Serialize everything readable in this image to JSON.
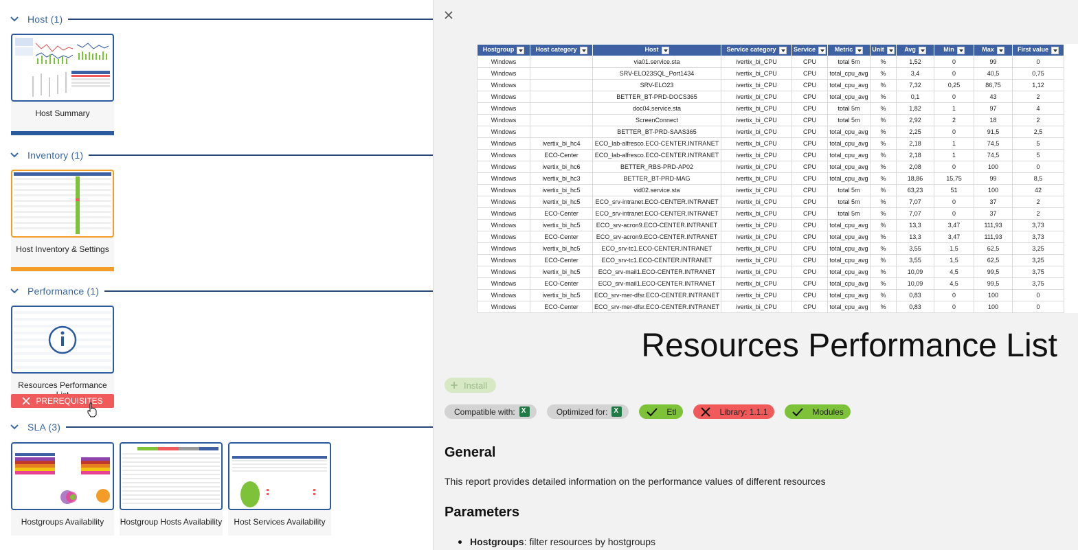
{
  "sections": {
    "host": {
      "title": "Host (1)",
      "card": {
        "label": "Host Summary",
        "bar_color": "#2c5a9e"
      }
    },
    "inventory": {
      "title": "Inventory (1)",
      "card": {
        "label": "Host Inventory & Settings",
        "bar_color": "#f39c28"
      }
    },
    "performance": {
      "title": "Performance (1)",
      "card": {
        "label": "Resources Performance List",
        "prerequisites_label": "PREREQUISITES"
      }
    },
    "sla": {
      "title": "SLA (3)",
      "cards": [
        {
          "label": "Hostgroups Availability"
        },
        {
          "label": "Hostgroup Hosts Availability"
        },
        {
          "label": "Host Services Availability"
        }
      ]
    }
  },
  "detail": {
    "title": "Resources Performance List",
    "install_label": "Install",
    "badges": {
      "compatible": "Compatible with:",
      "optimized": "Optimized for:",
      "etl": "Etl",
      "library": "Library: 1.1.1",
      "modules": "Modules"
    },
    "general_heading": "General",
    "general_text": "This report provides detailed information on the performance values of different resources",
    "parameters_heading": "Parameters",
    "param_name": "Hostgroups",
    "param_text": ": filter resources by hostgroups",
    "table": {
      "headers": [
        "Hostgroup",
        "Host category",
        "Host",
        "Service category",
        "Service",
        "Metric",
        "Unit",
        "Avg",
        "Min",
        "Max",
        "First value"
      ],
      "rows": [
        [
          "Windows",
          "",
          "via01.service.sta",
          "ivertix_bi_CPU",
          "CPU",
          "total 5m",
          "%",
          "1,52",
          "0",
          "99",
          "0"
        ],
        [
          "Windows",
          "",
          "SRV-ELO23SQL_Port1434",
          "ivertix_bi_CPU",
          "CPU",
          "total_cpu_avg",
          "%",
          "3,4",
          "0",
          "40,5",
          "0,75"
        ],
        [
          "Windows",
          "",
          "SRV-ELO23",
          "ivertix_bi_CPU",
          "CPU",
          "total_cpu_avg",
          "%",
          "7,32",
          "0,25",
          "86,75",
          "1,12"
        ],
        [
          "Windows",
          "",
          "BETTER_BT-PRD-DOCS365",
          "ivertix_bi_CPU",
          "CPU",
          "total_cpu_avg",
          "%",
          "0,1",
          "0",
          "43",
          "2"
        ],
        [
          "Windows",
          "",
          "doc04.service.sta",
          "ivertix_bi_CPU",
          "CPU",
          "total 5m",
          "%",
          "1,82",
          "1",
          "97",
          "4"
        ],
        [
          "Windows",
          "",
          "ScreenConnect",
          "ivertix_bi_CPU",
          "CPU",
          "total 5m",
          "%",
          "2,92",
          "2",
          "18",
          "2"
        ],
        [
          "Windows",
          "",
          "BETTER_BT-PRD-SAAS365",
          "ivertix_bi_CPU",
          "CPU",
          "total_cpu_avg",
          "%",
          "2,25",
          "0",
          "91,5",
          "2,5"
        ],
        [
          "Windows",
          "ivertix_bi_hc4",
          "ECO_lab-alfresco.ECO-CENTER.INTRANET",
          "ivertix_bi_CPU",
          "CPU",
          "total_cpu_avg",
          "%",
          "2,18",
          "1",
          "74,5",
          "5"
        ],
        [
          "Windows",
          "ECO-Center",
          "ECO_lab-alfresco.ECO-CENTER.INTRANET",
          "ivertix_bi_CPU",
          "CPU",
          "total_cpu_avg",
          "%",
          "2,18",
          "1",
          "74,5",
          "5"
        ],
        [
          "Windows",
          "ivertix_bi_hc6",
          "BETTER_RBS-PRD-AP02",
          "ivertix_bi_CPU",
          "CPU",
          "total_cpu_avg",
          "%",
          "2,08",
          "0",
          "100",
          "0"
        ],
        [
          "Windows",
          "ivertix_bi_hc3",
          "BETTER_BT-PRD-MAG",
          "ivertix_bi_CPU",
          "CPU",
          "total_cpu_avg",
          "%",
          "18,86",
          "15,75",
          "99",
          "8,5"
        ],
        [
          "Windows",
          "ivertix_bi_hc5",
          "vid02.service.sta",
          "ivertix_bi_CPU",
          "CPU",
          "total 5m",
          "%",
          "63,23",
          "51",
          "100",
          "42"
        ],
        [
          "Windows",
          "ivertix_bi_hc5",
          "ECO_srv-intranet.ECO-CENTER.INTRANET",
          "ivertix_bi_CPU",
          "CPU",
          "total 5m",
          "%",
          "7,07",
          "0",
          "37",
          "2"
        ],
        [
          "Windows",
          "ECO-Center",
          "ECO_srv-intranet.ECO-CENTER.INTRANET",
          "ivertix_bi_CPU",
          "CPU",
          "total 5m",
          "%",
          "7,07",
          "0",
          "37",
          "2"
        ],
        [
          "Windows",
          "ivertix_bi_hc5",
          "ECO_srv-acron9.ECO-CENTER.INTRANET",
          "ivertix_bi_CPU",
          "CPU",
          "total_cpu_avg",
          "%",
          "13,3",
          "3,47",
          "111,93",
          "3,73"
        ],
        [
          "Windows",
          "ECO-Center",
          "ECO_srv-acron9.ECO-CENTER.INTRANET",
          "ivertix_bi_CPU",
          "CPU",
          "total_cpu_avg",
          "%",
          "13,3",
          "3,47",
          "111,93",
          "3,73"
        ],
        [
          "Windows",
          "ivertix_bi_hc5",
          "ECO_srv-tc1.ECO-CENTER.INTRANET",
          "ivertix_bi_CPU",
          "CPU",
          "total_cpu_avg",
          "%",
          "3,55",
          "1,5",
          "62,5",
          "3,25"
        ],
        [
          "Windows",
          "ECO-Center",
          "ECO_srv-tc1.ECO-CENTER.INTRANET",
          "ivertix_bi_CPU",
          "CPU",
          "total_cpu_avg",
          "%",
          "3,55",
          "1,5",
          "62,5",
          "3,25"
        ],
        [
          "Windows",
          "ivertix_bi_hc5",
          "ECO_srv-mail1.ECO-CENTER.INTRANET",
          "ivertix_bi_CPU",
          "CPU",
          "total_cpu_avg",
          "%",
          "10,09",
          "4,5",
          "99,5",
          "3,75"
        ],
        [
          "Windows",
          "ECO-Center",
          "ECO_srv-mail1.ECO-CENTER.INTRANET",
          "ivertix_bi_CPU",
          "CPU",
          "total_cpu_avg",
          "%",
          "10,09",
          "4,5",
          "99,5",
          "3,75"
        ],
        [
          "Windows",
          "ivertix_bi_hc5",
          "ECO_srv-mer-dfsr.ECO-CENTER.INTRANET",
          "ivertix_bi_CPU",
          "CPU",
          "total_cpu_avg",
          "%",
          "0,83",
          "0",
          "100",
          "0"
        ],
        [
          "Windows",
          "ECO-Center",
          "ECO_srv-mer-dfsr.ECO-CENTER.INTRANET",
          "ivertix_bi_CPU",
          "CPU",
          "total_cpu_avg",
          "%",
          "0,83",
          "0",
          "100",
          "0"
        ]
      ]
    }
  },
  "colors": {
    "primary": "#2c5a9e",
    "accent_orange": "#f39c28",
    "danger": "#f05a5a",
    "success": "#7dc238"
  }
}
